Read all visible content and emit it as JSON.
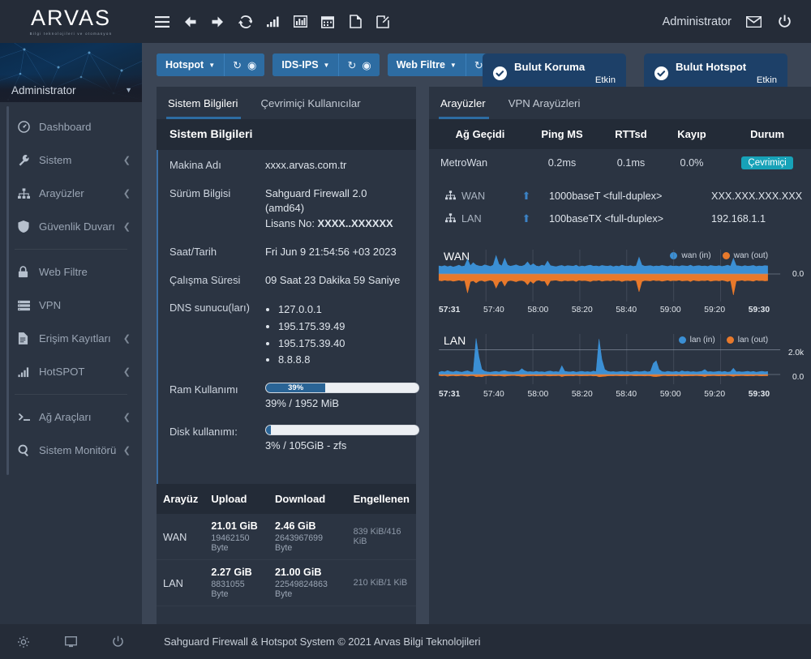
{
  "header": {
    "logo": "ARVAS",
    "logo_sub": "Bilgi teknolojileri ve otomasyon",
    "icons": [
      "menu-icon",
      "back-arrow-icon",
      "forward-arrow-icon",
      "refresh-icon",
      "signal-bars-icon",
      "bar-chart-icon",
      "calendar-icon",
      "document-icon",
      "edit-icon"
    ],
    "user": "Administrator",
    "mail_icon": "mail-icon",
    "power_icon": "power-icon"
  },
  "sidebar": {
    "user": "Administrator",
    "items": [
      {
        "label": "Dashboard",
        "icon": "dashboard-icon",
        "expandable": false
      },
      {
        "label": "Sistem",
        "icon": "wrench-icon",
        "expandable": true
      },
      {
        "label": "Arayüzler",
        "icon": "sitemap-icon",
        "expandable": true
      },
      {
        "label": "Güvenlik Duvarı",
        "icon": "shield-icon",
        "expandable": true
      },
      {
        "label": "Web Filtre",
        "icon": "lock-icon",
        "expandable": false
      },
      {
        "label": "VPN",
        "icon": "server-icon",
        "expandable": false
      },
      {
        "label": "Erişim Kayıtları",
        "icon": "file-lines-icon",
        "expandable": true
      },
      {
        "label": "HotSPOT",
        "icon": "signal-bars-icon",
        "expandable": true
      },
      {
        "label": "Ağ Araçları",
        "icon": "terminal-icon",
        "expandable": true
      },
      {
        "label": "Sistem Monitörü",
        "icon": "search-icon",
        "expandable": true
      }
    ]
  },
  "services": [
    {
      "label": "Hotspot",
      "refresh_icon": "refresh-icon",
      "power_icon": "power-circle-icon"
    },
    {
      "label": "IDS-IPS",
      "refresh_icon": "refresh-icon",
      "power_icon": "power-circle-icon"
    },
    {
      "label": "Web Filtre",
      "refresh_icon": "refresh-icon",
      "power_icon": "power-circle-icon"
    }
  ],
  "cloud": [
    {
      "title": "Bulut Koruma",
      "status": "Etkin",
      "icon": "check-circle-icon"
    },
    {
      "title": "Bulut Hotspot",
      "status": "Etkin",
      "icon": "check-circle-icon"
    }
  ],
  "left_panel": {
    "tabs": [
      {
        "label": "Sistem Bilgileri",
        "active": true
      },
      {
        "label": "Çevrimiçi Kullanıcılar",
        "active": false
      }
    ],
    "section_title": "Sistem Bilgileri",
    "rows": [
      {
        "key": "Makina Adı",
        "value": "xxxx.arvas.com.tr"
      },
      {
        "key": "Sürüm Bilgisi",
        "value_line1": "Sahguard Firewall 2.0 (amd64)",
        "value_line2_label": "Lisans No: ",
        "value_line2_value": "XXXX..XXXXXX"
      },
      {
        "key": "Saat/Tarih",
        "value": "Fri Jun 9 21:54:56 +03 2023"
      },
      {
        "key": "Çalışma Süresi",
        "value": "09 Saat 23 Dakika 59 Saniye"
      }
    ],
    "dns": {
      "key": "DNS sunucu(ları)",
      "servers": [
        "127.0.0.1",
        "195.175.39.49",
        "195.175.39.40",
        "8.8.8.8"
      ]
    },
    "ram": {
      "key": "Ram Kullanımı",
      "percent": 39,
      "bar_label": "39%",
      "caption": "39% / 1952 MiB"
    },
    "disk": {
      "key": "Disk kullanımı:",
      "percent": 3,
      "bar_label": "",
      "caption": "3% / 105GiB - zfs"
    },
    "traffic": {
      "columns": [
        "Arayüz",
        "Upload",
        "Download",
        "Engellenen"
      ],
      "rows": [
        {
          "iface": "WAN",
          "up_big": "21.01 GiB",
          "up_small": "19462150 Byte",
          "down_big": "2.46 GiB",
          "down_small": "2643967699 Byte",
          "blocked": "839 KiB/416 KiB"
        },
        {
          "iface": "LAN",
          "up_big": "2.27 GiB",
          "up_small": "8831055 Byte",
          "down_big": "21.00 GiB",
          "down_small": "22549824863 Byte",
          "blocked": "210 KiB/1 KiB"
        }
      ]
    }
  },
  "right_panel": {
    "tabs": [
      {
        "label": "Arayüzler",
        "active": true
      },
      {
        "label": "VPN Arayüzleri",
        "active": false
      }
    ],
    "gateway": {
      "columns": [
        "Ağ Geçidi",
        "Ping MS",
        "RTTsd",
        "Kayıp",
        "Durum"
      ],
      "rows": [
        {
          "name": "MetroWan",
          "ping": "0.2ms",
          "rttsd": "0.1ms",
          "loss": "0.0%",
          "status": "Çevrimiçi"
        }
      ]
    },
    "interfaces": [
      {
        "name": "WAN",
        "icon": "sitemap-icon",
        "arrow": "up-arrow-icon",
        "media": "1000baseT <full-duplex>",
        "ip": "XXX.XXX.XXX.XXX"
      },
      {
        "name": "LAN",
        "icon": "sitemap-icon",
        "arrow": "up-arrow-icon",
        "media": "100baseTX <full-duplex>",
        "ip": "192.168.1.1"
      }
    ]
  },
  "chart_data": [
    {
      "type": "area",
      "title": "WAN",
      "legend": [
        {
          "name": "wan (in)",
          "color": "#3b8fd4"
        },
        {
          "name": "wan (out)",
          "color": "#e8792b"
        }
      ],
      "legend_position": "top-right",
      "xlabel": "",
      "ylabel": "",
      "x_ticks": [
        "57:31",
        "57:40",
        "58:00",
        "58:20",
        "58:40",
        "59:00",
        "59:20",
        "59:30"
      ],
      "y_ticks": [
        "0.0"
      ],
      "ylim": [
        -1,
        1
      ],
      "grid": true,
      "series": [
        {
          "name": "wan (in)",
          "values": [
            0.3,
            0.28,
            0.31,
            0.27,
            0.3,
            0.26,
            0.29,
            0.33,
            0.28,
            0.3,
            0.55,
            0.31,
            0.42,
            0.33,
            0.3,
            0.29,
            0.34,
            0.31,
            0.28,
            0.33,
            0.68,
            0.36,
            0.3,
            0.58,
            0.33,
            0.29,
            0.31,
            0.34,
            0.3,
            0.29,
            0.33,
            0.45,
            0.31,
            0.38,
            0.3,
            0.28,
            0.33,
            0.3,
            0.48,
            0.31,
            0.29,
            0.27,
            0.3,
            0.32,
            0.28,
            0.31,
            0.3,
            0.29,
            0.33,
            0.27,
            0.3,
            0.28,
            0.31,
            0.33,
            0.29,
            0.3,
            0.28,
            0.32,
            0.3,
            0.29,
            0.31,
            0.27,
            0.3,
            0.28,
            0.33,
            0.3,
            0.29,
            0.31,
            0.28,
            0.3,
            0.62,
            0.33,
            0.29,
            0.3,
            0.31,
            0.28,
            0.3,
            0.29,
            0.32,
            0.3,
            0.28,
            0.31,
            0.29,
            0.3,
            0.28,
            0.31,
            0.3,
            0.29,
            0.33,
            0.28,
            0.3,
            0.31,
            0.29,
            0.3,
            0.28,
            0.32,
            0.3,
            0.29,
            0.31,
            0.28,
            0.3,
            0.33,
            0.29,
            0.58,
            0.31,
            0.3,
            0.28,
            0.31,
            0.29,
            0.3,
            0.32,
            0.28,
            0.3,
            0.29,
            0.31,
            0.3
          ]
        },
        {
          "name": "wan (out)",
          "values": [
            0.24,
            0.26,
            0.23,
            0.25,
            0.24,
            0.27,
            0.25,
            0.23,
            0.26,
            0.24,
            0.7,
            0.28,
            0.25,
            0.33,
            0.26,
            0.24,
            0.28,
            0.25,
            0.23,
            0.27,
            0.52,
            0.3,
            0.25,
            0.45,
            0.27,
            0.24,
            0.26,
            0.29,
            0.25,
            0.24,
            0.28,
            0.4,
            0.26,
            0.35,
            0.25,
            0.23,
            0.27,
            0.26,
            0.44,
            0.25,
            0.24,
            0.23,
            0.26,
            0.27,
            0.24,
            0.26,
            0.25,
            0.24,
            0.28,
            0.23,
            0.25,
            0.24,
            0.26,
            0.28,
            0.24,
            0.25,
            0.23,
            0.27,
            0.25,
            0.24,
            0.26,
            0.23,
            0.25,
            0.24,
            0.28,
            0.25,
            0.24,
            0.26,
            0.23,
            0.25,
            0.66,
            0.28,
            0.24,
            0.25,
            0.26,
            0.23,
            0.25,
            0.24,
            0.27,
            0.25,
            0.23,
            0.26,
            0.24,
            0.25,
            0.23,
            0.26,
            0.25,
            0.24,
            0.28,
            0.23,
            0.25,
            0.26,
            0.24,
            0.25,
            0.23,
            0.27,
            0.25,
            0.24,
            0.26,
            0.23,
            0.25,
            0.28,
            0.24,
            0.78,
            0.26,
            0.25,
            0.23,
            0.26,
            0.24,
            0.25,
            0.27,
            0.23,
            0.25,
            0.24,
            0.26,
            0.25
          ]
        }
      ]
    },
    {
      "type": "area",
      "title": "LAN",
      "legend": [
        {
          "name": "lan (in)",
          "color": "#3b8fd4"
        },
        {
          "name": "lan (out)",
          "color": "#e8792b"
        }
      ],
      "legend_position": "top-right",
      "xlabel": "",
      "ylabel": "",
      "x_ticks": [
        "57:31",
        "57:40",
        "58:00",
        "58:20",
        "58:40",
        "59:00",
        "59:20",
        "59:30"
      ],
      "y_ticks": [
        "2.0k",
        "0.0"
      ],
      "ylim": [
        0,
        3000
      ],
      "grid": true,
      "series": [
        {
          "name": "lan (in)",
          "values": [
            180,
            260,
            210,
            320,
            240,
            200,
            280,
            230,
            190,
            250,
            300,
            220,
            210,
            2900,
            1400,
            420,
            260,
            210,
            190,
            230,
            250,
            200,
            280,
            320,
            240,
            210,
            190,
            230,
            260,
            470,
            300,
            220,
            240,
            200,
            260,
            210,
            230,
            190,
            250,
            280,
            220,
            240,
            200,
            700,
            260,
            230,
            210,
            250,
            190,
            230,
            260,
            210,
            240,
            200,
            280,
            230,
            2850,
            1200,
            400,
            260,
            220,
            240,
            200,
            230,
            260,
            210,
            250,
            190,
            230,
            260,
            220,
            240,
            280,
            210,
            250,
            900,
            1100,
            400,
            240,
            200,
            260,
            230,
            210,
            250,
            190,
            300,
            230,
            260,
            210,
            240,
            200,
            230,
            260,
            400,
            220,
            240,
            200,
            230,
            260,
            210,
            250,
            190,
            230,
            500,
            220,
            240,
            200,
            230,
            260,
            210,
            250,
            190,
            230,
            260,
            220,
            240
          ]
        },
        {
          "name": "lan (out)",
          "values": [
            90,
            130,
            100,
            160,
            120,
            100,
            140,
            115,
            95,
            125,
            150,
            110,
            105,
            200,
            170,
            210,
            130,
            105,
            95,
            115,
            125,
            100,
            140,
            160,
            120,
            105,
            95,
            115,
            130,
            180,
            150,
            110,
            120,
            100,
            130,
            105,
            115,
            95,
            125,
            140,
            110,
            120,
            100,
            190,
            130,
            115,
            105,
            125,
            95,
            115,
            130,
            105,
            120,
            100,
            140,
            115,
            210,
            180,
            160,
            130,
            110,
            120,
            100,
            115,
            130,
            105,
            125,
            95,
            115,
            130,
            110,
            120,
            140,
            105,
            125,
            180,
            190,
            160,
            120,
            100,
            130,
            115,
            105,
            125,
            95,
            150,
            115,
            130,
            105,
            120,
            100,
            115,
            130,
            190,
            110,
            120,
            100,
            115,
            130,
            105,
            125,
            95,
            115,
            170,
            110,
            120,
            100,
            115,
            130,
            105,
            125,
            95,
            115,
            130,
            110,
            120
          ]
        }
      ]
    }
  ],
  "footer": {
    "icons": [
      "gear-icon",
      "monitor-icon",
      "power-icon"
    ],
    "text": "Sahguard Firewall & Hotspot System © 2021 Arvas Bilgi Teknolojileri"
  },
  "colors": {
    "accent_blue": "#2d6ca2",
    "badge_teal": "#17a2b8",
    "chart_in": "#3b8fd4",
    "chart_out": "#e8792b",
    "panel_bg": "#2b3442",
    "content_bg": "#3b4555"
  }
}
